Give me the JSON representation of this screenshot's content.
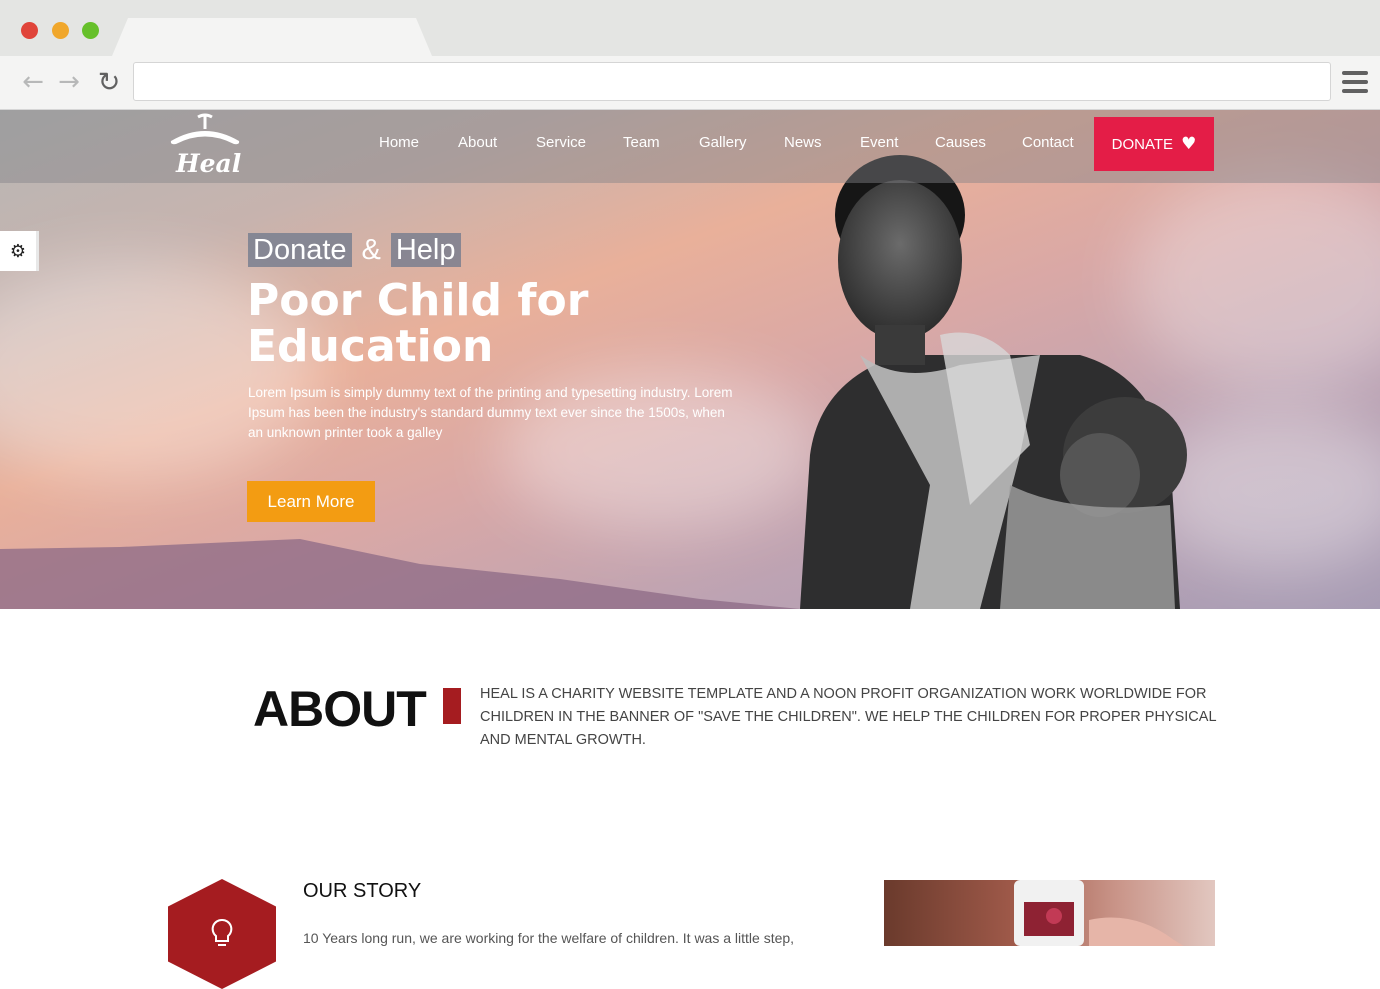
{
  "browser": {
    "address": "",
    "tab_title": ""
  },
  "header": {
    "logo_text": "Heal",
    "nav": [
      "Home",
      "About",
      "Service",
      "Team",
      "Gallery",
      "News",
      "Event",
      "Causes",
      "Contact"
    ],
    "donate_label": "DONATE"
  },
  "hero": {
    "tag_word1": "Donate",
    "tag_amp": "&",
    "tag_word2": "Help",
    "title": "Poor Child for Education",
    "text": "Lorem Ipsum is simply dummy text of the printing and typesetting industry. Lorem Ipsum has been the industry's standard dummy text ever since the 1500s, when an unknown printer took a galley",
    "button": "Learn More"
  },
  "about": {
    "title": "ABOUT",
    "text": "HEAL IS A CHARITY WEBSITE TEMPLATE AND A NOON PROFIT ORGANIZATION WORK WORLDWIDE FOR CHILDREN IN THE BANNER OF \"SAVE THE CHILDREN\". WE HELP THE CHILDREN FOR PROPER PHYSICAL AND MENTAL GROWTH."
  },
  "story": {
    "title": "OUR STORY",
    "text": "10 Years long run, we are working for the welfare of children. It was a little step,"
  },
  "colors": {
    "donate": "#e41d47",
    "learn_more": "#f39c12",
    "accent": "#a51c20"
  }
}
